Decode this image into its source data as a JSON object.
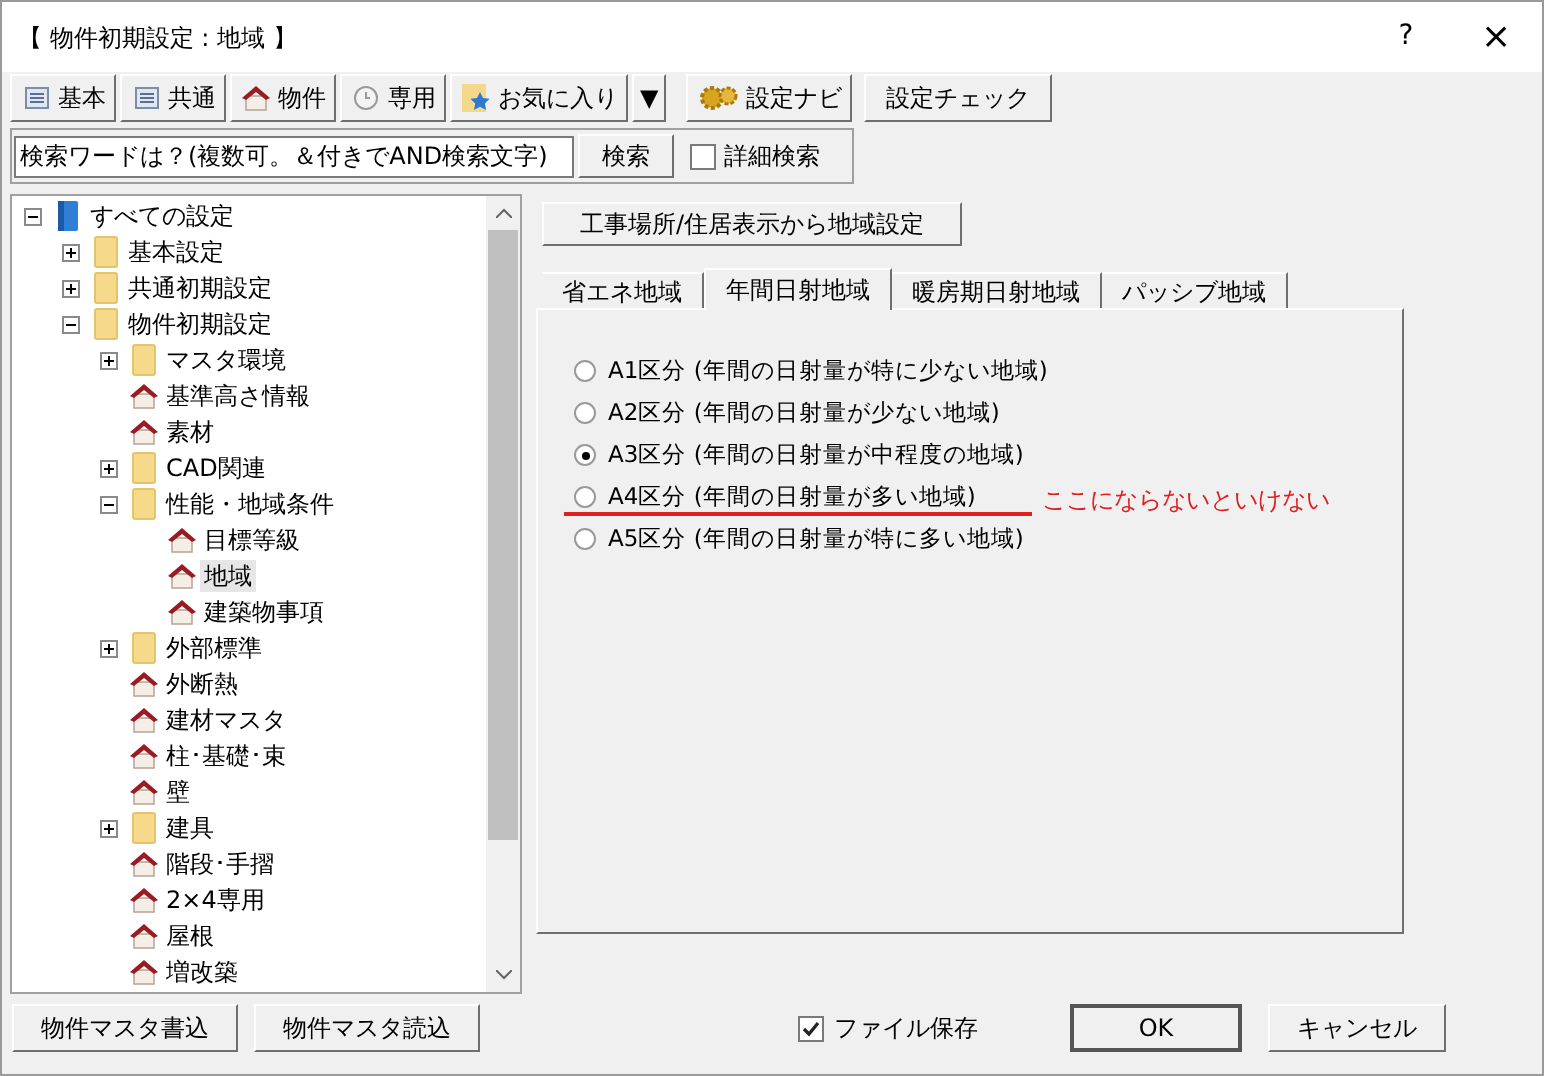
{
  "window": {
    "title": "【 物件初期設定 : 地域 】",
    "help": "?",
    "close": "×"
  },
  "toolbar": [
    {
      "label": "基本",
      "kind": "doc"
    },
    {
      "label": "共通",
      "kind": "doc"
    },
    {
      "label": "物件",
      "kind": "house"
    },
    {
      "label": "専用",
      "kind": "clock"
    },
    {
      "label": "お気に入り",
      "kind": "star"
    },
    {
      "label": "▼",
      "kind": "dropdown"
    },
    {
      "label": "設定ナビ",
      "kind": "gear"
    },
    {
      "label": "設定チェック",
      "kind": "plain"
    }
  ],
  "search": {
    "value": "検索ワードは？(複数可。＆付きでAND検索文字)",
    "button": "検索",
    "detail": {
      "label": "詳細検索",
      "checked": false
    }
  },
  "tree": [
    {
      "label": "すべての設定",
      "kind": "root",
      "expanded": true,
      "selected": false,
      "children": [
        {
          "label": "基本設定",
          "kind": "folder",
          "expanded": false,
          "selected": false
        },
        {
          "label": "共通初期設定",
          "kind": "folder",
          "expanded": false,
          "selected": false
        },
        {
          "label": "物件初期設定",
          "kind": "folder",
          "expanded": true,
          "selected": false,
          "children": [
            {
              "label": "マスタ環境",
              "kind": "folder",
              "expanded": false,
              "selected": false
            },
            {
              "label": "基準高さ情報",
              "kind": "item",
              "selected": false
            },
            {
              "label": "素材",
              "kind": "item",
              "selected": false
            },
            {
              "label": "CAD関連",
              "kind": "folder",
              "expanded": false,
              "selected": false
            },
            {
              "label": "性能・地域条件",
              "kind": "folder",
              "expanded": true,
              "selected": false,
              "children": [
                {
                  "label": "目標等級",
                  "kind": "item",
                  "selected": false
                },
                {
                  "label": "地域",
                  "kind": "item",
                  "selected": true
                },
                {
                  "label": "建築物事項",
                  "kind": "item",
                  "selected": false
                }
              ]
            },
            {
              "label": "外部標準",
              "kind": "folder",
              "expanded": false,
              "selected": false
            },
            {
              "label": "外断熱",
              "kind": "item",
              "selected": false
            },
            {
              "label": "建材マスタ",
              "kind": "item",
              "selected": false
            },
            {
              "label": "柱･基礎･束",
              "kind": "item",
              "selected": false
            },
            {
              "label": "壁",
              "kind": "item",
              "selected": false
            },
            {
              "label": "建具",
              "kind": "folder",
              "expanded": false,
              "selected": false
            },
            {
              "label": "階段･手摺",
              "kind": "item",
              "selected": false
            },
            {
              "label": "2×4専用",
              "kind": "item",
              "selected": false
            },
            {
              "label": "屋根",
              "kind": "item",
              "selected": false
            },
            {
              "label": "増改築",
              "kind": "item",
              "selected": false
            }
          ]
        }
      ]
    }
  ],
  "region_button": "工事場所/住居表示から地域設定",
  "tabs": [
    {
      "label": "省エネ地域",
      "selected": false
    },
    {
      "label": "年間日射地域",
      "selected": true
    },
    {
      "label": "暖房期日射地域",
      "selected": false
    },
    {
      "label": "パッシブ地域",
      "selected": false
    }
  ],
  "options": [
    {
      "label": "A1区分 (年間の日射量が特に少ない地域)",
      "selected": false
    },
    {
      "label": "A2区分 (年間の日射量が少ない地域)",
      "selected": false
    },
    {
      "label": "A3区分 (年間の日射量が中程度の地域)",
      "selected": true
    },
    {
      "label": "A4区分 (年間の日射量が多い地域)",
      "selected": false
    },
    {
      "label": "A5区分 (年間の日射量が特に多い地域)",
      "selected": false
    }
  ],
  "annotation": {
    "text": "ここにならないといけない"
  },
  "bottom": {
    "left_buttons": [
      "物件マスタ書込",
      "物件マスタ読込"
    ],
    "save": {
      "label": "ファイル保存",
      "checked": true
    },
    "ok": "OK",
    "cancel": "キャンセル"
  }
}
